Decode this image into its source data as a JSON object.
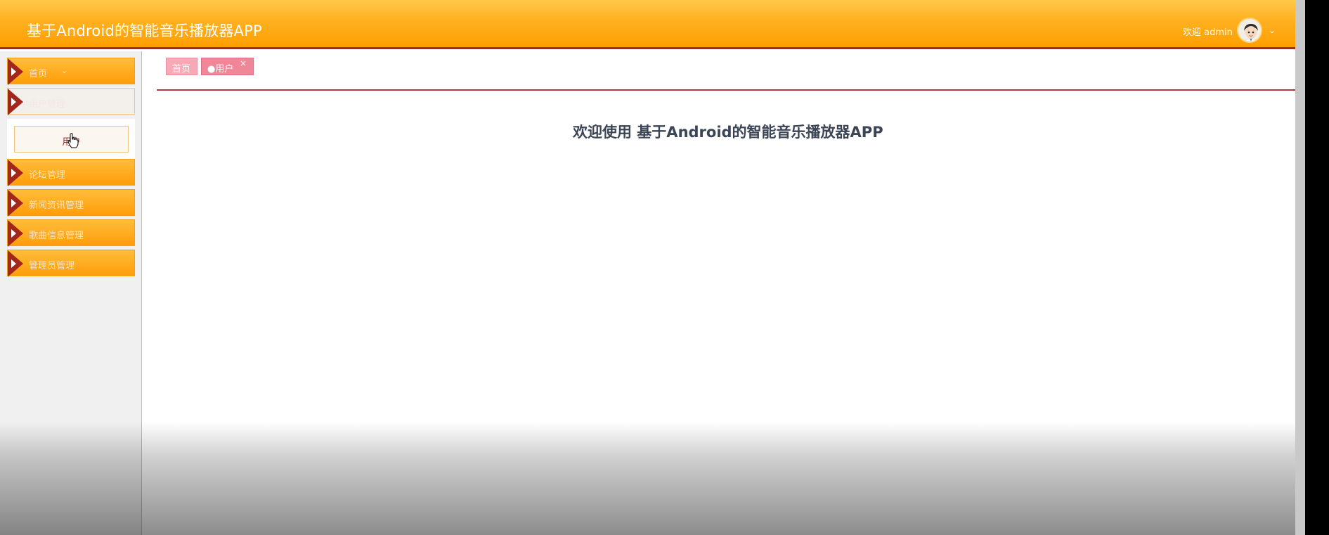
{
  "header": {
    "title": "基于Android的智能音乐播放器APP",
    "welcome_text": "欢迎 admin",
    "avatar_icon": "user-avatar-icon",
    "menu_icon": "chevron-down-icon"
  },
  "sidebar": {
    "items": [
      {
        "label": "首页",
        "icon": "triangle-right-icon",
        "has_caret": true
      },
      {
        "label": "用户管理",
        "icon": "triangle-right-icon",
        "expanded": true
      },
      {
        "label": "论坛管理",
        "icon": "triangle-right-icon"
      },
      {
        "label": "新闻资讯管理",
        "icon": "triangle-right-icon"
      },
      {
        "label": "歌曲信息管理",
        "icon": "triangle-right-icon"
      },
      {
        "label": "管理员管理",
        "icon": "triangle-right-icon"
      }
    ],
    "submenu": {
      "items": [
        {
          "label": "用户"
        }
      ]
    }
  },
  "tabs": [
    {
      "label": "首页"
    },
    {
      "label": "●用户",
      "close_label": "×"
    }
  ],
  "main": {
    "welcome_message": "欢迎使用 基于Android的智能音乐播放器APP"
  },
  "colors": {
    "header_orange": "#ffa500",
    "accent_red": "#a8291c",
    "tab_pink": "#ef8799"
  }
}
